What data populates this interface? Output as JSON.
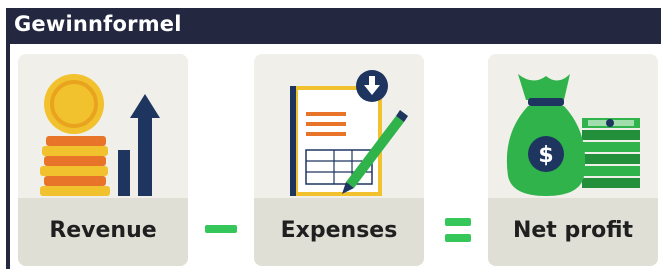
{
  "header": {
    "title": "Gewinnformel"
  },
  "cards": [
    {
      "label": "Revenue",
      "icon": "coins-and-growth-chart-icon"
    },
    {
      "label": "Expenses",
      "icon": "expense-report-with-pen-icon"
    },
    {
      "label": "Net profit",
      "icon": "money-bag-and-cash-icon"
    }
  ],
  "operators": [
    {
      "icon": "minus-icon"
    },
    {
      "icon": "equals-icon"
    }
  ],
  "colors": {
    "header_bg": "#232840",
    "card_bg": "#f0efe9",
    "label_bg": "#dfdfd6",
    "operator_green": "#35c75a",
    "navy": "#1e3560",
    "gold": "#f2c12e",
    "orange": "#e8742a",
    "money_green": "#2fb34a"
  }
}
